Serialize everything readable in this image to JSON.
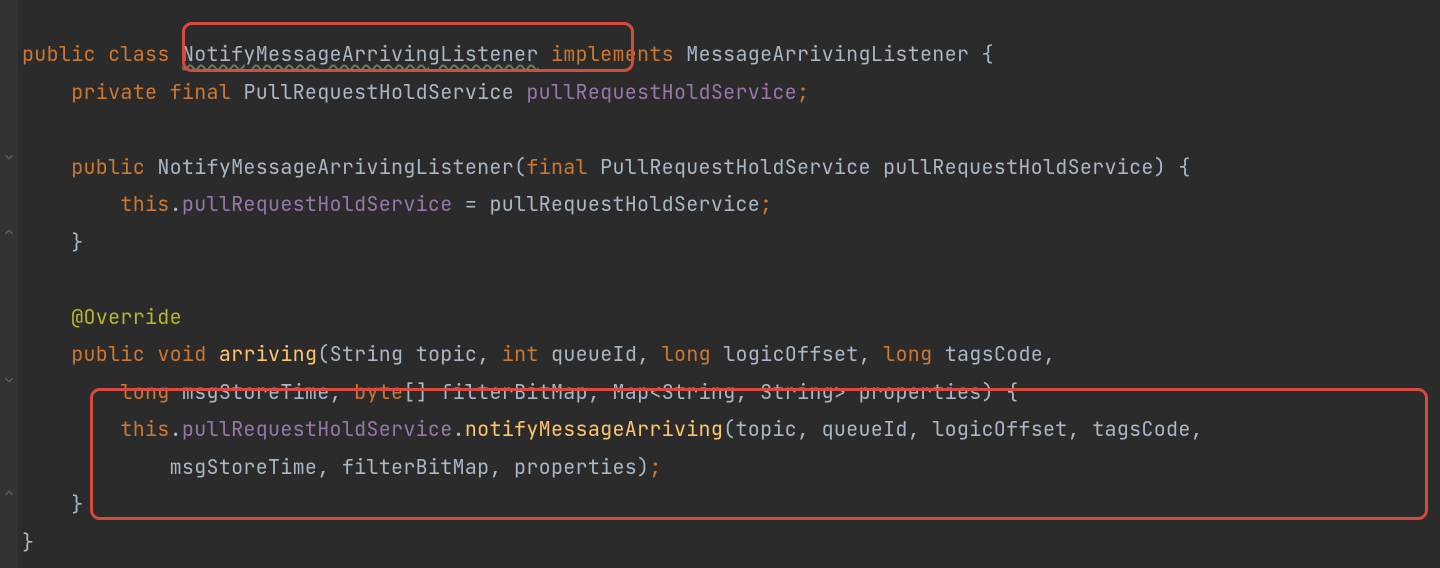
{
  "language": "Java",
  "colors": {
    "background": "#2b2b2b",
    "keyword": "#cc7832",
    "identifier": "#a9b7c6",
    "field": "#9876aa",
    "method": "#ffc66d",
    "annotation": "#bbb529",
    "highlight_box": "#d64b3e"
  },
  "code": {
    "l1": {
      "kw_public": "public",
      "kw_class": "class",
      "class_name": "NotifyMessageArrivingListener",
      "kw_implements": "implements",
      "iface": "MessageArrivingListener",
      "brace_open": "{"
    },
    "l2": {
      "kw_private": "private",
      "kw_final": "final",
      "type": "PullRequestHoldService",
      "field": "pullRequestHoldService",
      "semi": ";"
    },
    "l3": {
      "kw_public": "public",
      "ctor": "NotifyMessageArrivingListener",
      "paren_open": "(",
      "kw_final": "final",
      "ptype": "PullRequestHoldService",
      "pname": "pullRequestHoldService",
      "paren_close": ")",
      "brace_open": "{"
    },
    "l4": {
      "kw_this": "this",
      "dot": ".",
      "field": "pullRequestHoldService",
      "eq": " = ",
      "rhs": "pullRequestHoldService",
      "semi": ";"
    },
    "l5": {
      "brace_close": "}"
    },
    "l6": {
      "annotation": "@Override"
    },
    "l7": {
      "kw_public": "public",
      "kw_void": "void",
      "method": "arriving",
      "paren_open": "(",
      "p1t": "String",
      "p1n": "topic",
      "c1": ", ",
      "p2t": "int",
      "p2n": "queueId",
      "c2": ", ",
      "p3t": "long",
      "p3n": "logicOffset",
      "c3": ", ",
      "p4t": "long",
      "p4n": "tagsCode",
      "c4": ","
    },
    "l8": {
      "p5t": "long",
      "p5n": "msgStoreTime",
      "c5": ", ",
      "p6t": "byte",
      "brackets": "[]",
      "p6n": "filterBitMap",
      "c6": ", ",
      "p7t": "Map",
      "lt": "<",
      "g1": "String",
      "gc": ", ",
      "g2": "String",
      "gt": ">",
      "p7n": "properties",
      "paren_close": ")",
      "brace_open": "{"
    },
    "l9": {
      "kw_this": "this",
      "dot1": ".",
      "field": "pullRequestHoldService",
      "dot2": ".",
      "call": "notifyMessageArriving",
      "paren_open": "(",
      "a1": "topic",
      "c1": ", ",
      "a2": "queueId",
      "c2": ", ",
      "a3": "logicOffset",
      "c3": ", ",
      "a4": "tagsCode",
      "c4": ","
    },
    "l10": {
      "a5": "msgStoreTime",
      "c5": ", ",
      "a6": "filterBitMap",
      "c6": ", ",
      "a7": "properties",
      "paren_close": ")",
      "semi": ";"
    },
    "l11": {
      "brace_close": "}"
    },
    "l12": {
      "brace_close": "}"
    }
  },
  "highlights": [
    {
      "name": "class-name-highlight",
      "target": "NotifyMessageArrivingListener (declaration)"
    },
    {
      "name": "method-body-highlight",
      "target": "notifyMessageArriving call block"
    }
  ]
}
